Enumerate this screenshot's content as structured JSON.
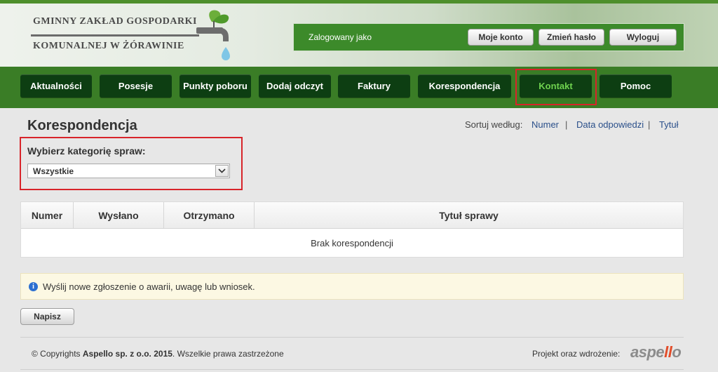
{
  "logo": {
    "line1": "GMINNY ZAKŁAD GOSPODARKI",
    "line2": "KOMUNALNEJ W ŻÓRAWINIE"
  },
  "userbar": {
    "logged_as": "Zalogowany jako",
    "buttons": [
      "Moje konto",
      "Zmień hasło",
      "Wyloguj"
    ]
  },
  "nav": {
    "items": [
      "Aktualności",
      "Posesje",
      "Punkty poboru",
      "Dodaj odczyt",
      "Faktury",
      "Korespondencja",
      "Kontakt",
      "Pomoc"
    ],
    "active": "Kontakt"
  },
  "main": {
    "title": "Korespondencja",
    "sort": {
      "label": "Sortuj według:",
      "links": [
        "Numer",
        "Data odpowiedzi",
        "Tytuł"
      ],
      "separator": "|"
    },
    "category": {
      "label": "Wybierz kategorię spraw:",
      "selected": "Wszystkie"
    },
    "table": {
      "columns": [
        "Numer",
        "Wysłano",
        "Otrzymano",
        "Tytuł sprawy"
      ],
      "empty_text": "Brak korespondencji"
    },
    "notice": "Wyślij nowe zgłoszenie o awarii, uwagę lub wniosek.",
    "write_button": "Napisz"
  },
  "footer": {
    "copy_prefix": "© Copyrights ",
    "company": "Aspello sp. z o.o. 2015",
    "copy_suffix": ". Wszelkie prawa zastrzeżone",
    "project_label": "Projekt oraz wdrożenie:",
    "brand_a": "aspe",
    "brand_b": "ll",
    "brand_c": "o"
  },
  "colors": {
    "nav_bg": "#3a7d26",
    "nav_button": "#0d3e12",
    "active_nav_text": "#6fd24f",
    "highlight_box": "#d8242a"
  }
}
